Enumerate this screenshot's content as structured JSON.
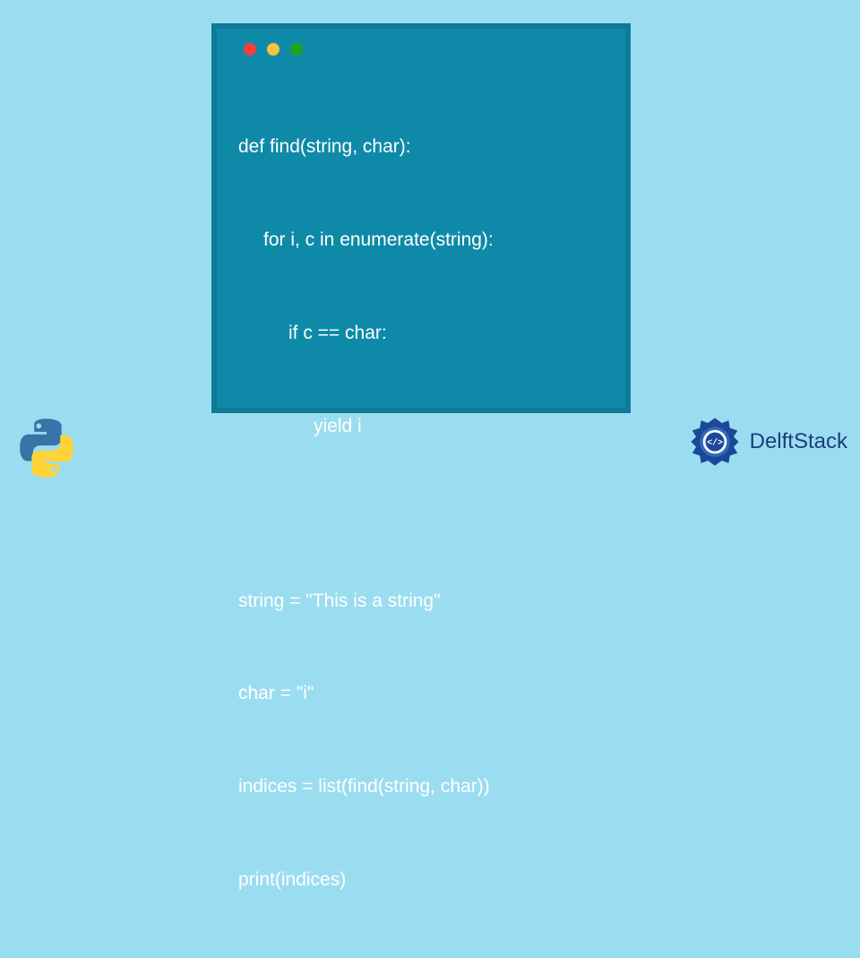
{
  "code": {
    "line1": "def find(string, char):",
    "line2": "for i, c in enumerate(string):",
    "line3": "if c == char:",
    "line4": "yield i",
    "line5": "string = \"This is a string\"",
    "line6": "char = \"i\"",
    "line7": "indices = list(find(string, char))",
    "line8": "print(indices)"
  },
  "brand": {
    "name_part1": "Delft",
    "name_part2": "Stack"
  },
  "colors": {
    "bg": "#9bddf0",
    "card": "#0e8aa8",
    "border": "#0d7a96",
    "dot_red": "#fb3c3c",
    "dot_yellow": "#fac23d",
    "dot_green": "#1ea41e",
    "brand_blue": "#1b3d7a"
  }
}
